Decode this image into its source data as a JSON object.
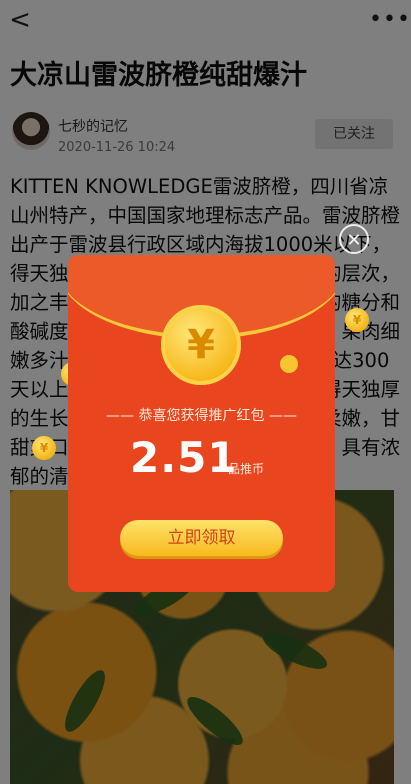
{
  "nav": {
    "back_icon": "back-icon",
    "more_icon": "more-icon",
    "back_glyph": "<",
    "more_glyph": "•••"
  },
  "article": {
    "title": "大凉山雷波脐橙纯甜爆汁",
    "author": "七秒的记忆",
    "date": "2020-11-26 10:24",
    "follow_label": "已关注",
    "body": "KITTEN KNOWLEDGE雷波脐橙，四川省凉山州特产，中国国家地理标志产品。雷波脐橙出产于雷波县行政区域内海拔1000米以下，得天独厚的自然条件使其形成了丰富的层次，加之丰富的光照和温差，使脐橙果实的糖分和酸碱度，让雷波脐橙果实的风味独特，果肉细嫩多汁、爽快，1260小时，无霜期长达300天以上，非常有利于脐橙生长，有着得天独厚的生长条件。雷波脐橙的无渣，肉质柔嫩，甘甜爽口，在中国众多脐橙中，以脆甜，具有浓郁的清香为独特的品质特点。"
  },
  "red_packet": {
    "close_icon": "close-icon",
    "coin_symbol": "¥",
    "subtitle": "恭喜您获得推广红包",
    "amount": "2.51",
    "unit": "品推币",
    "claim_label": "立即领取"
  }
}
